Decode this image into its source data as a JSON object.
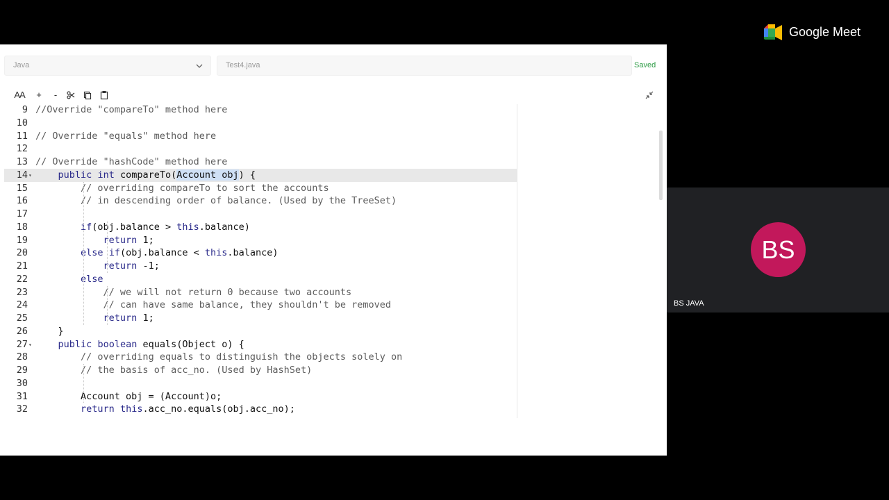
{
  "meet": {
    "brand": "Google Meet",
    "participant": {
      "initials": "BS",
      "name": "BS JAVA",
      "avatar_color": "#c2185b"
    }
  },
  "editor_header": {
    "language": "Java",
    "filename": "Test4.java",
    "status": "Saved",
    "status_color": "#2e9c46"
  },
  "toolbar": {
    "font_size": "AA",
    "zoom_in": "+",
    "zoom_out": "-"
  },
  "code_lines": [
    {
      "num": "9",
      "text": "//Override \"compareTo\" method here"
    },
    {
      "num": "10",
      "text": ""
    },
    {
      "num": "11",
      "text": "// Override \"equals\" method here"
    },
    {
      "num": "12",
      "text": ""
    },
    {
      "num": "13",
      "text": "// Override \"hashCode\" method here"
    },
    {
      "num": "14",
      "text": "    public int compareTo(Account obj) {"
    },
    {
      "num": "15",
      "text": "        // overriding compareTo to sort the accounts"
    },
    {
      "num": "16",
      "text": "        // in descending order of balance. (Used by the TreeSet)"
    },
    {
      "num": "17",
      "text": ""
    },
    {
      "num": "18",
      "text": "        if(obj.balance > this.balance)"
    },
    {
      "num": "19",
      "text": "            return 1;"
    },
    {
      "num": "20",
      "text": "        else if(obj.balance < this.balance)"
    },
    {
      "num": "21",
      "text": "            return -1;"
    },
    {
      "num": "22",
      "text": "        else"
    },
    {
      "num": "23",
      "text": "            // we will not return 0 because two accounts"
    },
    {
      "num": "24",
      "text": "            // can have same balance, they shouldn't be removed"
    },
    {
      "num": "25",
      "text": "            return 1;"
    },
    {
      "num": "26",
      "text": "    }"
    },
    {
      "num": "27",
      "text": "    public boolean equals(Object o) {"
    },
    {
      "num": "28",
      "text": "        // overriding equals to distinguish the objects solely on"
    },
    {
      "num": "29",
      "text": "        // the basis of acc_no. (Used by HashSet)"
    },
    {
      "num": "30",
      "text": ""
    },
    {
      "num": "31",
      "text": "        Account obj = (Account)o;"
    },
    {
      "num": "32",
      "text": "        return this.acc_no.equals(obj.acc_no);"
    }
  ]
}
